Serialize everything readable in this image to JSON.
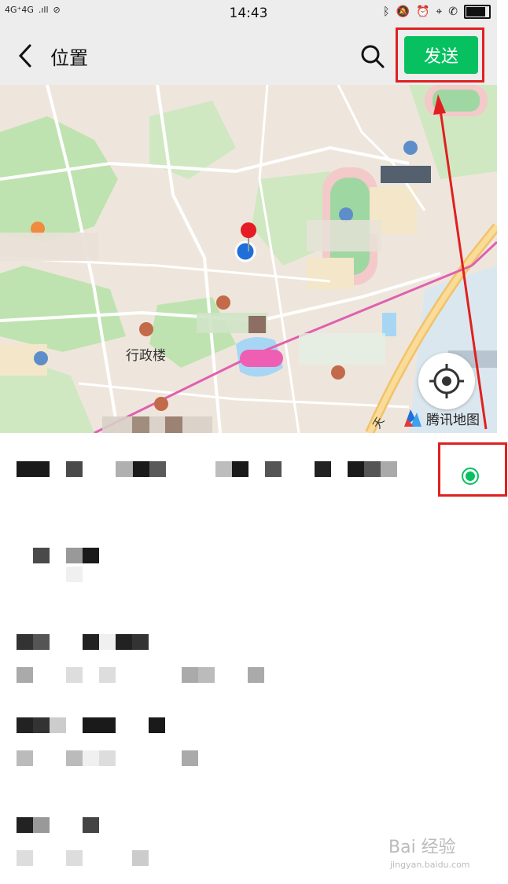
{
  "status": {
    "network": "4G⁺4G",
    "signal": ".ıll",
    "time": "14:43",
    "icons": [
      "bluetooth-icon",
      "mute-icon",
      "alarm-icon",
      "location-icon",
      "phone-hd-icon",
      "battery-icon"
    ]
  },
  "header": {
    "title": "位置",
    "send_label": "发送"
  },
  "map": {
    "label_admin": "行政楼",
    "brand": "腾讯地图",
    "road_char": "天"
  },
  "colors": {
    "accent": "#07c160",
    "highlight_box": "#e02020",
    "map_bg": "#eee6dc",
    "park": "#bfe3b0",
    "water": "#a7d6f5"
  },
  "watermark": {
    "main": "Bai 经验",
    "sub": "jingyan.baidu.com"
  }
}
